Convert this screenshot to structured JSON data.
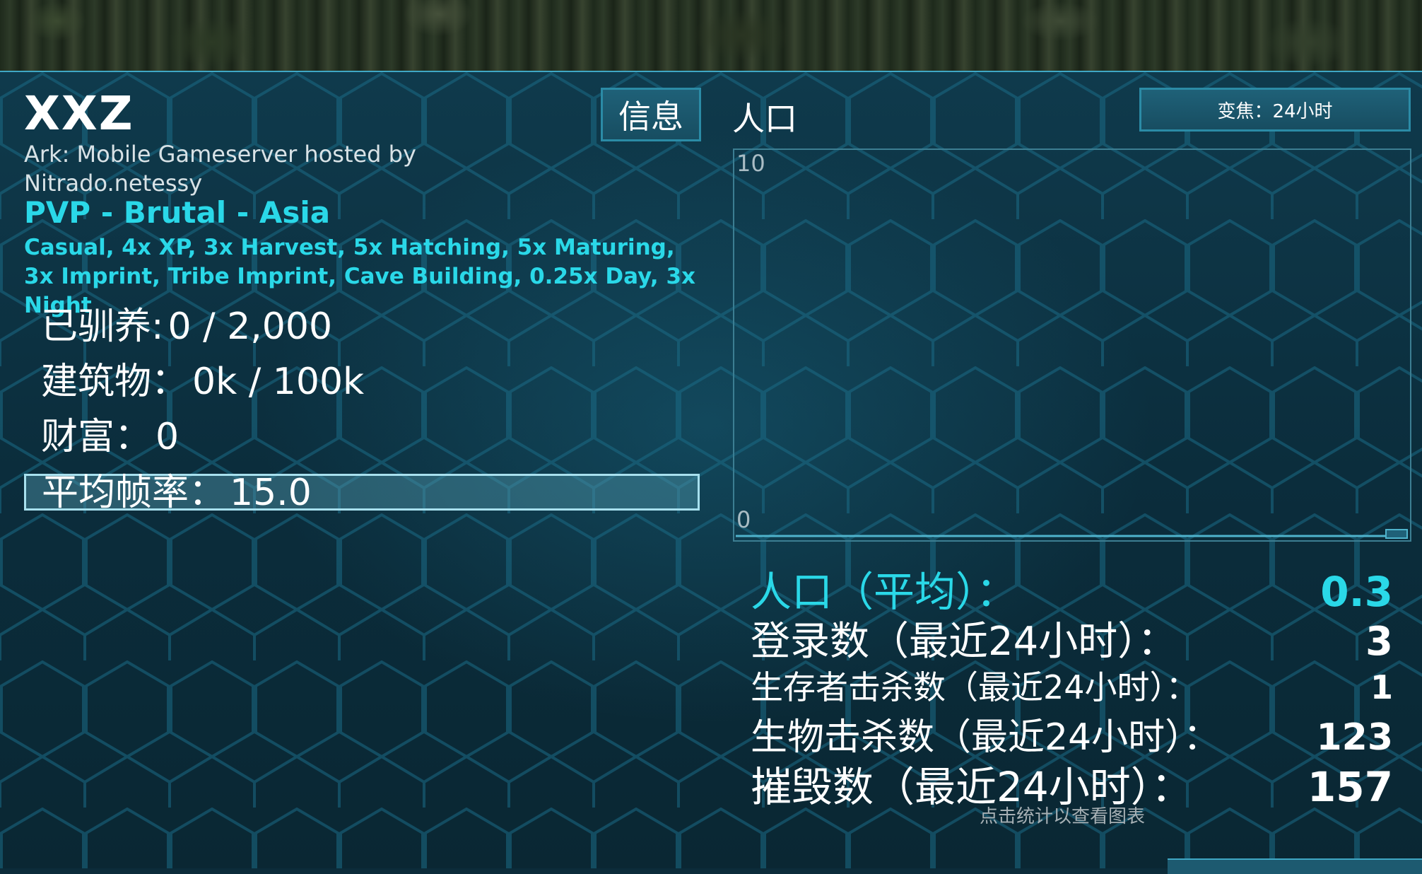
{
  "server": {
    "name": "XXZ",
    "hosted": "Ark: Mobile Gameserver hosted by Nitrado.netessy",
    "mode": "PVP - Brutal - Asia",
    "settings": "Casual, 4x XP, 3x Harvest, 5x Hatching, 5x Maturing, 3x Imprint, Tribe Imprint, Cave Building, 0.25x Day, 3x Night"
  },
  "stats_left": {
    "tamed_label": "已驯养:",
    "tamed_value": "0 / 2,000",
    "structures_label": "建筑物：",
    "structures_value": "0k / 100k",
    "wealth_label": "财富：",
    "wealth_value": "0",
    "fps_label": "平均帧率：",
    "fps_value": "15.0"
  },
  "tabs": {
    "info": "信息",
    "population": "人口"
  },
  "zoom_button": "变焦：24小时",
  "chart_data": {
    "type": "line",
    "y_max_label": "10",
    "y_min_label": "0",
    "ylim": [
      0,
      10
    ],
    "values": [
      0,
      0,
      0,
      0,
      0,
      0,
      0,
      0,
      0,
      0,
      0,
      0,
      0,
      0,
      0,
      0,
      0,
      0,
      0,
      0,
      0,
      0,
      0,
      0
    ]
  },
  "stats_right": [
    {
      "label": "人口（平均）：",
      "value": "0.3"
    },
    {
      "label": "登录数（最近24小时）：",
      "value": "3"
    },
    {
      "label": "生存者击杀数（最近24小时）：",
      "value": "1"
    },
    {
      "label": "生物击杀数（最近24小时）：",
      "value": "123"
    },
    {
      "label": "摧毁数（最近24小时）：",
      "value": "157"
    }
  ],
  "hint": "点击统计以查看图表",
  "colors": {
    "accent": "#2ad8e8",
    "panel": "#0f3a4c",
    "button": "#1f6178"
  }
}
